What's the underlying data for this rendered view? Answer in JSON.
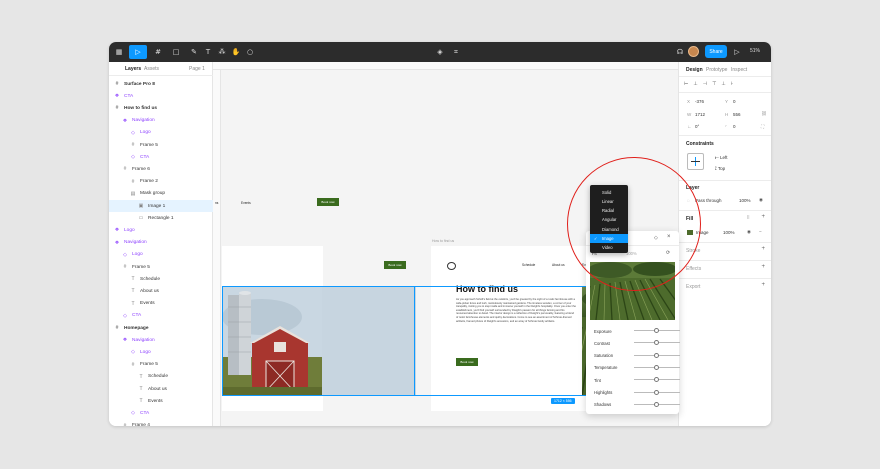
{
  "toolbar": {
    "share_label": "Share",
    "zoom": "51%"
  },
  "left_panel": {
    "tabs": [
      "Layers",
      "Assets"
    ],
    "page": "Page 1",
    "layers": [
      {
        "label": "Surface Pro 8",
        "type": "frame",
        "indent": 0,
        "bold": true
      },
      {
        "label": "CTA",
        "type": "component",
        "indent": 0
      },
      {
        "label": "How to find us",
        "type": "frame",
        "indent": 0,
        "bold": true
      },
      {
        "label": "Navigation",
        "type": "component",
        "indent": 1
      },
      {
        "label": "Logo",
        "type": "instance",
        "indent": 2
      },
      {
        "label": "Frame 5",
        "type": "frame",
        "indent": 2
      },
      {
        "label": "CTA",
        "type": "instance",
        "indent": 2
      },
      {
        "label": "Frame 6",
        "type": "frame",
        "indent": 1
      },
      {
        "label": "Frame 2",
        "type": "frame",
        "indent": 2
      },
      {
        "label": "Mask group",
        "type": "group",
        "indent": 2
      },
      {
        "label": "Image 1",
        "type": "image",
        "indent": 3,
        "selected": true
      },
      {
        "label": "Rectangle 1",
        "type": "rect",
        "indent": 3
      },
      {
        "label": "Logo",
        "type": "component",
        "indent": 0
      },
      {
        "label": "Navigation",
        "type": "component",
        "indent": 0
      },
      {
        "label": "Logo",
        "type": "instance",
        "indent": 1
      },
      {
        "label": "Frame 5",
        "type": "frame",
        "indent": 1
      },
      {
        "label": "Schedule",
        "type": "text",
        "indent": 2
      },
      {
        "label": "About us",
        "type": "text",
        "indent": 2
      },
      {
        "label": "Events",
        "type": "text",
        "indent": 2
      },
      {
        "label": "CTA",
        "type": "instance",
        "indent": 1
      },
      {
        "label": "Homepage",
        "type": "frame",
        "indent": 0,
        "bold": true
      },
      {
        "label": "Navigation",
        "type": "component",
        "indent": 1
      },
      {
        "label": "Logo",
        "type": "instance",
        "indent": 2
      },
      {
        "label": "Frame 5",
        "type": "frame",
        "indent": 2
      },
      {
        "label": "Schedule",
        "type": "text",
        "indent": 3
      },
      {
        "label": "About us",
        "type": "text",
        "indent": 3
      },
      {
        "label": "Events",
        "type": "text",
        "indent": 3
      },
      {
        "label": "CTA",
        "type": "instance",
        "indent": 2
      },
      {
        "label": "Frame 4",
        "type": "frame",
        "indent": 1
      }
    ]
  },
  "canvas": {
    "frame_label": "How to find us",
    "nav_events": "Events",
    "book_now": "Book now",
    "nav": [
      "Schedule",
      "About us",
      "Events"
    ],
    "hero_title": "How to find us",
    "hero_body": "As you approach Scholl's field at the outskirts, you'll be greeted by the sight of a rustic farmhouse with a wide-picket fence and lush, meticulously maintained gardens. The timeless wooden, a corner of your tranquility, inviting you to step inside and immerse yourself in the Dwight's hospitality. Once you enter the establishment, you'll find yourself surrounded by Dwight's passion for all things farming and his renowned attention to detail. The interior design is a reflection of Dwight's personality, featuring a blend of rustic farmhouse elements and quirky decorations. Come to see an assortment of Schrute-themed artifacts, framed photos of Dwight's ancestors, and an array of Schrute family artifacts.",
    "size_badge": "1712 × 556"
  },
  "popover": {
    "fit_label": "Fit",
    "opacity": "100%",
    "adjustments": [
      "Exposure",
      "Contrast",
      "Saturation",
      "Temperature",
      "Tint",
      "Highlights",
      "Shadows"
    ]
  },
  "dropdown": {
    "items": [
      "Solid",
      "Linear",
      "Radial",
      "Angular",
      "Diamond",
      "Image",
      "Video"
    ],
    "selected": "Image"
  },
  "right_panel": {
    "tabs": [
      "Design",
      "Prototype",
      "Inspect"
    ],
    "x": "-376",
    "y": "0",
    "w": "1712",
    "h": "556",
    "rotation": "0°",
    "radius": "0",
    "constraints_title": "Constraints",
    "constraint_h": "Left",
    "constraint_v": "Top",
    "layer_title": "Layer",
    "blend": "Pass through",
    "layer_opacity": "100%",
    "fill_title": "Fill",
    "fill_type": "Image",
    "fill_opacity": "100%",
    "stroke_title": "Stroke",
    "effects_title": "Effects",
    "export_title": "Export"
  },
  "colors": {
    "accent": "#0d99ff",
    "component": "#8c3fff",
    "cta_green": "#3a6b1e",
    "highlight_circle": "#e0201b"
  }
}
